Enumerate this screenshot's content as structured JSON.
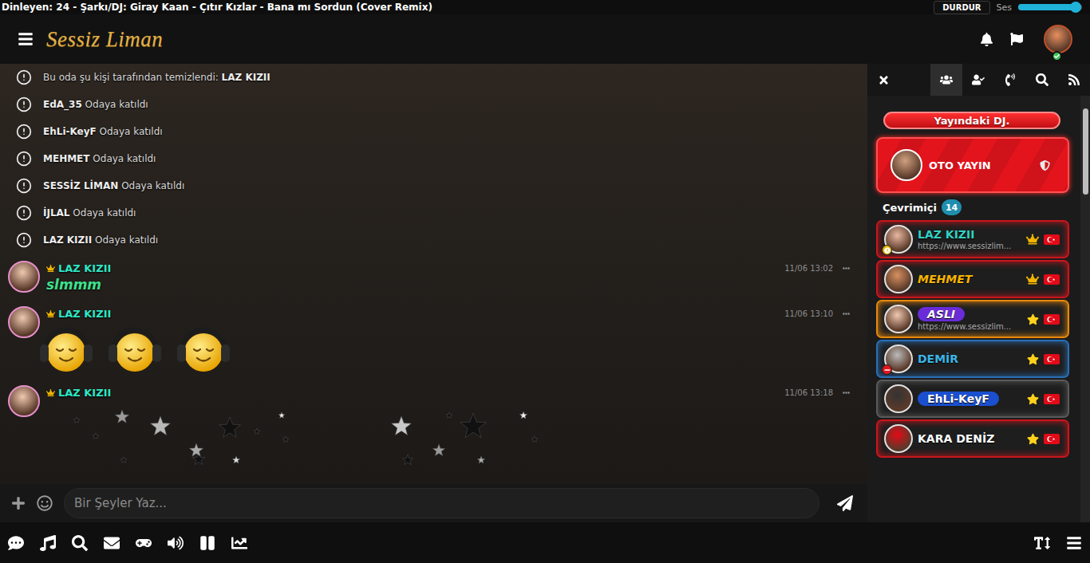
{
  "top_bar": {
    "now_playing": "Dinleyen: 24 - Şarkı/DJ: Giray Kaan - Çıtır Kızlar - Bana mı Sordun (Cover Remix)",
    "stop_button": "DURDUR",
    "volume_label": "Ses",
    "volume_level": 0.9
  },
  "header": {
    "logo": "Sessiz Liman",
    "user_online": true
  },
  "system_messages": [
    {
      "prefix": "Bu oda şu kişi tarafından temizlendi: ",
      "name": "LAZ KIZII",
      "suffix": ""
    },
    {
      "prefix": "",
      "name": "EdA_35",
      "suffix": " Odaya katıldı"
    },
    {
      "prefix": "",
      "name": "EhLi-KeyF",
      "suffix": " Odaya katıldı"
    },
    {
      "prefix": "",
      "name": "MEHMET",
      "suffix": " Odaya katıldı"
    },
    {
      "prefix": "",
      "name": "SESSİZ LİMAN",
      "suffix": " Odaya katıldı"
    },
    {
      "prefix": "",
      "name": "İJLAL",
      "suffix": " Odaya katıldı"
    },
    {
      "prefix": "",
      "name": "LAZ KIZII",
      "suffix": " Odaya katıldı"
    }
  ],
  "messages": [
    {
      "user": "LAZ KIZII",
      "time": "11/06 13:02",
      "kind": "text",
      "text": "slmmm"
    },
    {
      "user": "LAZ KIZII",
      "time": "11/06 13:10",
      "kind": "emoji",
      "count": 3
    },
    {
      "user": "LAZ KIZII",
      "time": "11/06 13:18",
      "kind": "stars"
    }
  ],
  "composer": {
    "placeholder": "Bir Şeyler Yaz..."
  },
  "panel": {
    "tabs": [
      {
        "kind": "users",
        "selected": true
      },
      {
        "kind": "friends",
        "selected": false
      },
      {
        "kind": "calls",
        "selected": false
      },
      {
        "kind": "search",
        "selected": false
      },
      {
        "kind": "feed",
        "selected": false
      }
    ],
    "dj_label": "Yayındaki DJ.",
    "dj": {
      "name": "OTO YAYIN"
    },
    "online_label": "Çevrimiçi",
    "online_count": "14",
    "users": [
      {
        "name": "LAZ KIZII",
        "subtitle": "https://www.sessizlim...",
        "color": "#c8161d",
        "name_color": "#33d1c4",
        "name_kind": "plain",
        "italic": false,
        "rank": "crown",
        "status": "away"
      },
      {
        "name": "MEHMET",
        "color": "#c8161d",
        "name_color": "#f7b500",
        "name_kind": "plain",
        "italic": true,
        "rank": "crown",
        "status": "none"
      },
      {
        "name": "ASLI",
        "subtitle": "https://www.sessizlim...",
        "color": "#e8890c",
        "name_color": "#6a2cd8",
        "name_kind": "pill",
        "italic": true,
        "rank": "star",
        "status": "none"
      },
      {
        "name": "DEMİR",
        "color": "#2a6fb5",
        "name_color": "#3cb4e6",
        "name_kind": "plain",
        "italic": false,
        "rank": "star",
        "status": "busy"
      },
      {
        "name": "EhLi-KeyF",
        "color": "#5a5a5a",
        "name_color": "#1a4fd0",
        "name_kind": "pill",
        "italic": false,
        "rank": "star",
        "status": "none"
      },
      {
        "name": "KARA DENİZ",
        "color": "#c8161d",
        "name_color": "#ffffff",
        "name_kind": "plain",
        "italic": false,
        "rank": "star",
        "status": "none"
      }
    ]
  }
}
